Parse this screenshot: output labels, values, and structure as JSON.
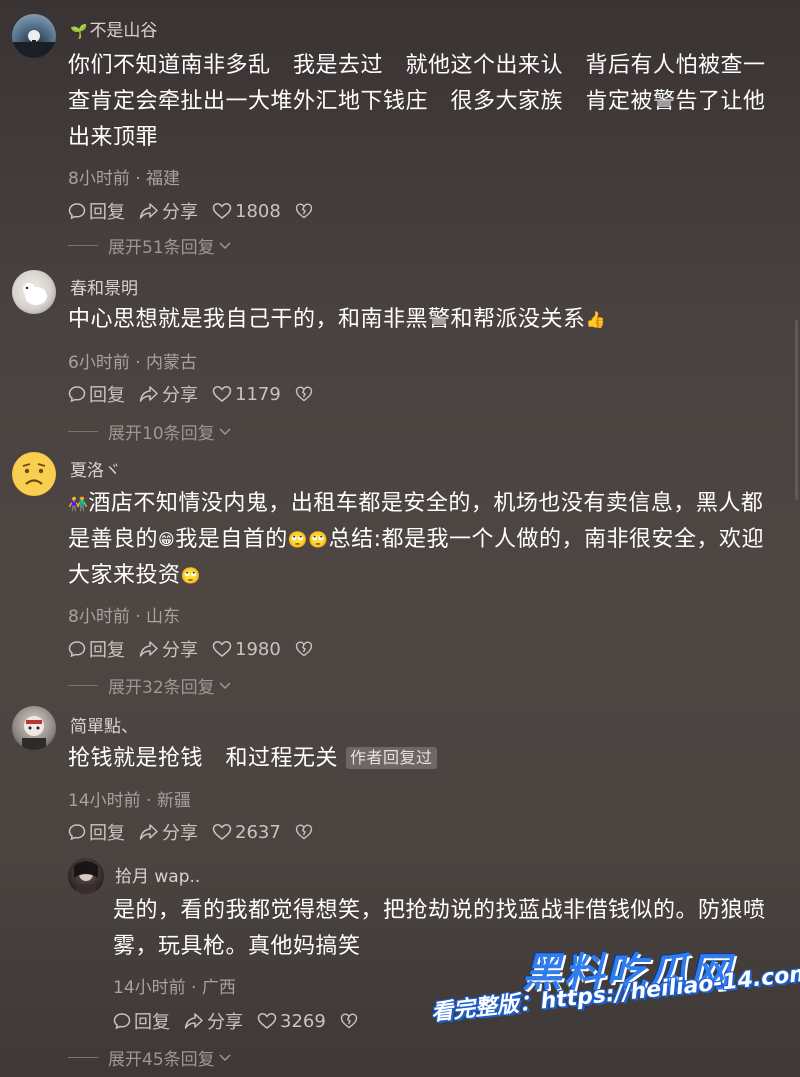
{
  "comments": [
    {
      "username": "不是山谷",
      "text": "你们不知道南非多乱　我是去过　就他这个出来认　背后有人怕被查一查肯定会牵扯出一大堆外汇地下钱庄　很多大家族　肯定被警告了让他出来顶罪",
      "meta": "8小时前 · 福建",
      "reply_label": "回复",
      "share_label": "分享",
      "likes": "1808",
      "expand_label": "展开51条回复"
    },
    {
      "username": "春和景明",
      "text": "中心思想就是我自己干的，和南非黑警和帮派没关系",
      "meta": "6小时前 · 内蒙古",
      "reply_label": "回复",
      "share_label": "分享",
      "likes": "1179",
      "expand_label": "展开10条回复"
    },
    {
      "username": "夏洛ヾ",
      "text_a": "酒店不知情没内鬼，出租车都是安全的，机场也没有卖信息，黑人都是善良的",
      "text_b": "我是自首的",
      "text_c": "总结:都是我一个人做的，南非很安全，欢迎大家来投资",
      "meta": "8小时前 · 山东",
      "reply_label": "回复",
      "share_label": "分享",
      "likes": "1980",
      "expand_label": "展开32条回复"
    },
    {
      "username": "简單點、",
      "text": "抢钱就是抢钱　和过程无关",
      "author_tag": "作者回复过",
      "meta": "14小时前 · 新疆",
      "reply_label": "回复",
      "share_label": "分享",
      "likes": "2637"
    }
  ],
  "reply": {
    "username": "拾月 wap..",
    "text": "是的，看的我都觉得想笑，把抢劫说的找蓝战非借钱似的。防狼喷雾，玩具枪。真他妈搞笑",
    "meta": "14小时前 · 广西",
    "reply_label": "回复",
    "share_label": "分享",
    "likes": "3269",
    "expand_label": "展开45条回复"
  },
  "watermark": {
    "brand": "黑料吃瓜网",
    "url_text": "看完整版：https://heiliao-14.com"
  },
  "colors": {
    "background": "#4a4240",
    "text": "#ffffff",
    "meta": "#a8a19e",
    "watermark_blue": "#2f7cf0"
  }
}
